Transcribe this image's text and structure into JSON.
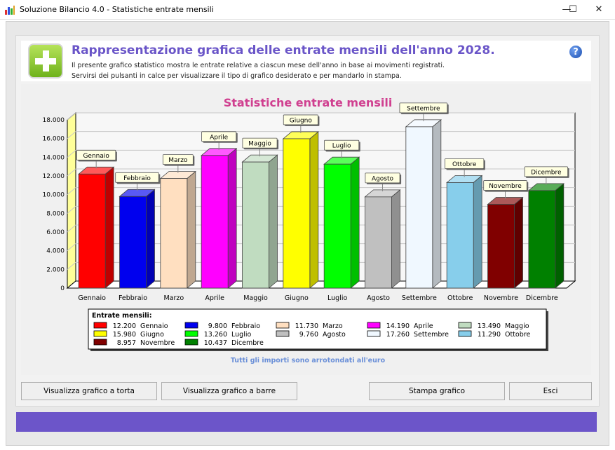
{
  "window": {
    "title": "Soluzione Bilancio 4.0 - Statistiche entrate mensili",
    "minimize": "—",
    "maximize": "☐",
    "close": "✕"
  },
  "header": {
    "title": "Rappresentazione grafica delle entrate mensili dell'anno 2028.",
    "line1": "Il presente grafico statistico mostra le entrate relative a ciascun mese dell'anno in base ai movimenti registrati.",
    "line2": "Servirsi dei pulsanti in calce per visualizzare il tipo di grafico desiderato e per mandarlo in stampa.",
    "help": "?"
  },
  "chart_data": {
    "type": "bar",
    "title": "Statistiche entrate mensili",
    "categories": [
      "Gennaio",
      "Febbraio",
      "Marzo",
      "Aprile",
      "Maggio",
      "Giugno",
      "Luglio",
      "Agosto",
      "Settembre",
      "Ottobre",
      "Novembre",
      "Dicembre"
    ],
    "values": [
      12200,
      9800,
      11730,
      14190,
      13490,
      15980,
      13260,
      9760,
      17260,
      11290,
      8957,
      10437
    ],
    "value_labels": [
      "12.200",
      "9.800",
      "11.730",
      "14.190",
      "13.490",
      "15.980",
      "13.260",
      "9.760",
      "17.260",
      "11.290",
      "8.957",
      "10.437"
    ],
    "colors": [
      "#ff0000",
      "#0000ee",
      "#ffdfc0",
      "#ff00ff",
      "#c0dcc0",
      "#ffff00",
      "#00ff00",
      "#c0c0c0",
      "#f0f8ff",
      "#87ceeb",
      "#800000",
      "#008000"
    ],
    "ylim": [
      0,
      18000
    ],
    "yticks": [
      "0",
      "2.000",
      "4.000",
      "6.000",
      "8.000",
      "10.000",
      "12.000",
      "14.000",
      "16.000",
      "18.000"
    ],
    "grid": true,
    "legend_title": "Entrate mensili:",
    "legend_position": "bottom",
    "note": "Tutti gli importi sono arrotondati all'euro"
  },
  "buttons": {
    "pie": "Visualizza grafico a torta",
    "bars": "Visualizza grafico a barre",
    "print": "Stampa grafico",
    "exit": "Esci"
  }
}
